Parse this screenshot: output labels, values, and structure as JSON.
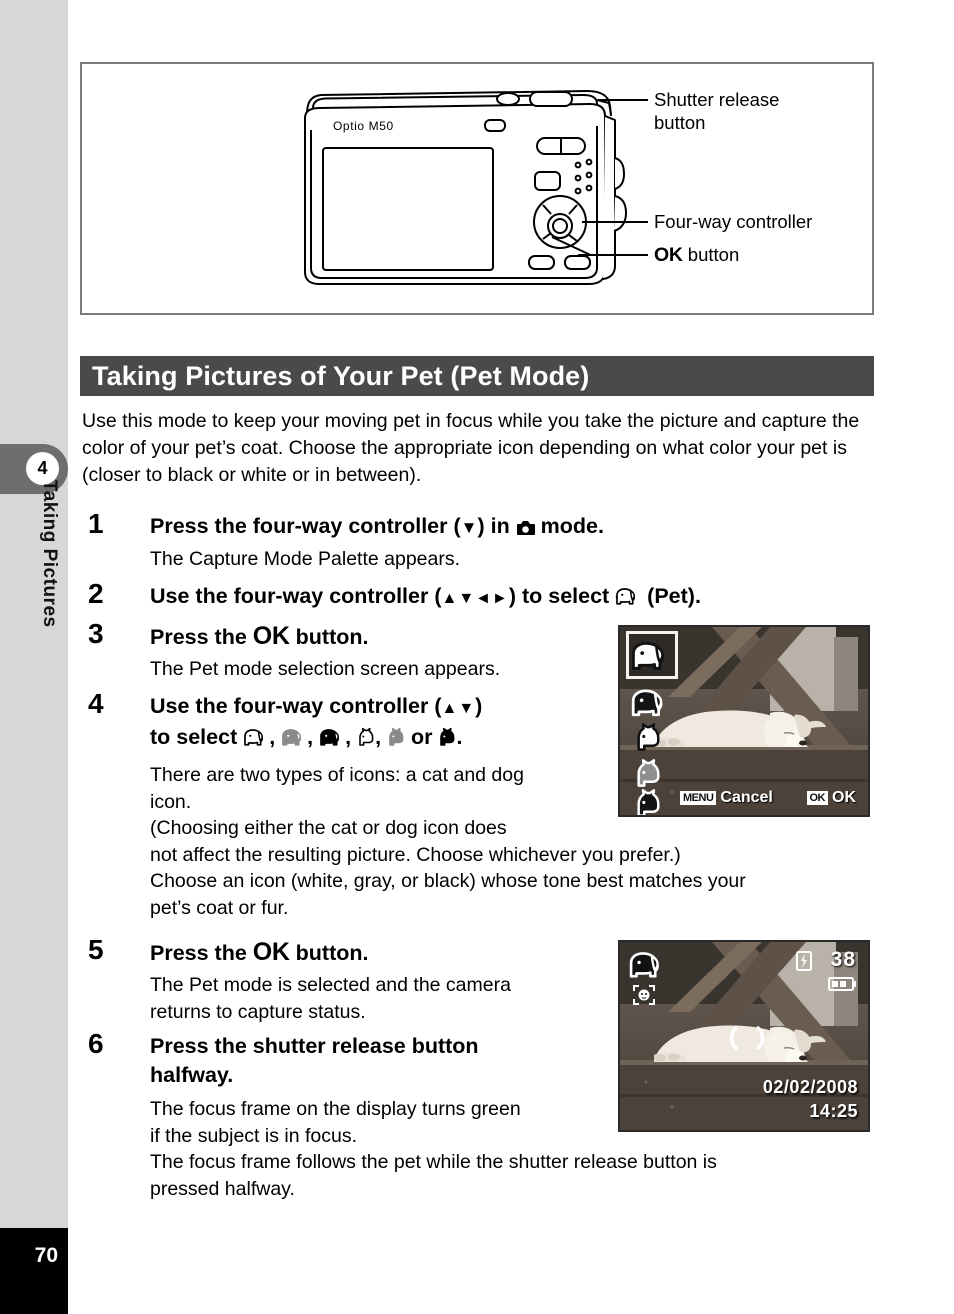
{
  "sidebar": {
    "chapter_number": "4",
    "chapter_label": "Taking Pictures",
    "page_number": "70"
  },
  "figure": {
    "camera_model": "Optio M50",
    "callouts": [
      {
        "label_line1": "Shutter release",
        "label_line2": "button"
      },
      {
        "label_line1": "Four-way controller",
        "label_line2": ""
      },
      {
        "label_ok": "OK",
        "label_rest": " button"
      }
    ]
  },
  "section": {
    "title": "Taking Pictures of Your Pet (Pet Mode)",
    "intro": "Use this mode to keep your moving pet in focus while you take the picture and capture the color of your pet’s coat. Choose the appropriate icon depending on what color your pet is (closer to black or white or in between)."
  },
  "steps": [
    {
      "number": "1",
      "head_pre": "Press the four-way controller (",
      "head_arrow": "▼",
      "head_mid": ") in ",
      "head_icon": "camera-mode-icon",
      "head_post": " mode.",
      "body": "The Capture Mode Palette appears."
    },
    {
      "number": "2",
      "head_pre": "Use the four-way controller (",
      "head_arrows": "▲▼◄►",
      "head_mid": ") to select ",
      "head_icon": "pet-dog-white-icon",
      "head_post": " (Pet).",
      "body": ""
    },
    {
      "number": "3",
      "head_pre": "Press the ",
      "head_ok": "OK",
      "head_post": " button.",
      "body": "The Pet mode selection screen appears."
    },
    {
      "number": "4",
      "head_line1_pre": "Use the four-way controller (",
      "head_line1_arrows": "▲▼",
      "head_line1_post": ")",
      "head_line2_pre": "to select ",
      "head_line2_icons": [
        "dog-white-icon",
        "dog-gray-icon",
        "dog-black-icon",
        "cat-white-icon",
        "cat-gray-icon",
        "cat-black-icon"
      ],
      "head_line2_or": "or",
      "head_line2_period": ".",
      "body_lines": [
        "There are two types of icons: a cat and dog",
        "icon.",
        "(Choosing either the cat or dog icon does",
        "not affect the resulting picture. Choose whichever you prefer.)",
        "Choose an icon (white, gray, or black) whose tone best matches your",
        "pet’s coat or fur."
      ]
    },
    {
      "number": "5",
      "head_pre": "Press the ",
      "head_ok": "OK",
      "head_post": " button.",
      "body_lines": [
        "The Pet mode is selected and the camera",
        "returns to capture status."
      ]
    },
    {
      "number": "6",
      "head_line1": "Press the shutter release button",
      "head_line2": "halfway.",
      "body_lines": [
        "The focus frame on the display turns green",
        "if the subject is in focus.",
        "The focus frame follows the pet while the shutter release button is",
        "pressed halfway."
      ]
    }
  ],
  "screens": {
    "select": {
      "menu_badge": "MENU",
      "menu_label": "Cancel",
      "ok_badge": "OK",
      "ok_label": "OK",
      "icon_list": [
        "dog-white-icon",
        "dog-black-icon",
        "cat-white-icon",
        "cat-gray-icon",
        "cat-black-icon"
      ],
      "selected_index": 0
    },
    "capture": {
      "mode_icon": "pet-dog-icon",
      "face_detect_icon": "pet-detect-icon",
      "flash_icon": "flash-off-icon",
      "shots_remaining": "38",
      "battery_icon": "battery-icon",
      "date": "02/02/2008",
      "time": "14:25",
      "focus_frame": "focus-bracket"
    }
  },
  "colors": {
    "title_bar_bg": "#4a4a4a",
    "sidebar_bg": "#d7d7d7",
    "chapter_tab_bg": "#6e6e6e",
    "page_block_bg": "#000000",
    "figure_border": "#7a7a7a"
  }
}
